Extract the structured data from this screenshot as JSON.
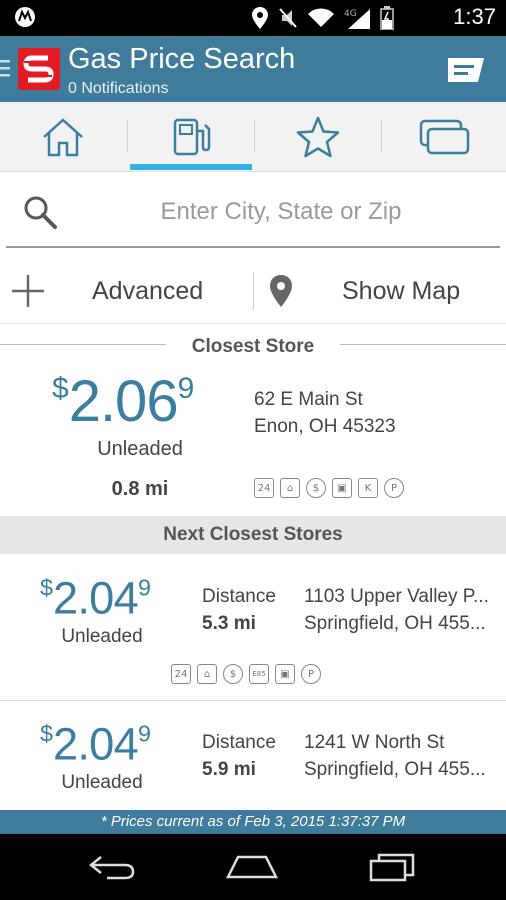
{
  "status_bar": {
    "time": "1:37",
    "network_label": "4G LTE"
  },
  "app_bar": {
    "title": "Gas Price Search",
    "subtitle": "0 Notifications"
  },
  "tabs": [
    {
      "icon": "home-icon",
      "selected": false
    },
    {
      "icon": "gas-pump-icon",
      "selected": true
    },
    {
      "icon": "star-icon",
      "selected": false
    },
    {
      "icon": "cards-icon",
      "selected": false
    }
  ],
  "search": {
    "placeholder": "Enter City, State or Zip"
  },
  "actions": {
    "advanced_label": "Advanced",
    "map_label": "Show Map"
  },
  "closest": {
    "header": "Closest Store",
    "currency": "$",
    "price_main": "2.06",
    "price_tenth": "9",
    "grade": "Unleaded",
    "distance": "0.8 mi",
    "address_line1": "62 E Main St",
    "address_line2": "Enon, OH  45323",
    "amenities": [
      "24",
      "car-wash",
      "atm",
      "diesel",
      "k",
      "p"
    ]
  },
  "next_header": "Next Closest Stores",
  "stores": [
    {
      "currency": "$",
      "price_main": "2.04",
      "price_tenth": "9",
      "grade": "Unleaded",
      "distance_label": "Distance",
      "distance": "5.3 mi",
      "address_line1": "1103 Upper Valley P...",
      "address_line2": "Springfield, OH  455...",
      "amenities": [
        "24",
        "car-wash",
        "atm",
        "E85",
        "diesel",
        "p"
      ]
    },
    {
      "currency": "$",
      "price_main": "2.04",
      "price_tenth": "9",
      "grade": "Unleaded",
      "distance_label": "Distance",
      "distance": "5.9 mi",
      "address_line1": "1241 W North St",
      "address_line2": "Springfield, OH  455...",
      "amenities": []
    }
  ],
  "footer": "* Prices current as of Feb 3, 2015 1:37:37 PM",
  "colors": {
    "app_bar": "#3f7c9b",
    "accent": "#2fb3e3",
    "price": "#3b7ea0",
    "logo": "#e31b23"
  }
}
